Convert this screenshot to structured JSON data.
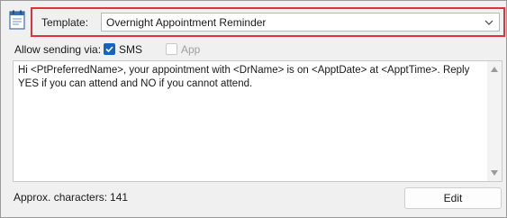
{
  "template": {
    "label": "Template:",
    "selected": "Overnight Appointment Reminder",
    "icon": "notepad-icon",
    "highlight_color": "#e0323d"
  },
  "sending": {
    "label": "Allow sending via:",
    "sms": {
      "label": "SMS",
      "checked": true
    },
    "app": {
      "label": "App",
      "checked": false,
      "disabled": true
    }
  },
  "message": {
    "text": "Hi <PtPreferredName>, your appointment with <DrName> is on <ApptDate> at <ApptTime>. Reply YES if you can attend and NO if you cannot attend."
  },
  "footer": {
    "approx_label": "Approx. characters:",
    "approx_count": "141",
    "edit_label": "Edit"
  },
  "colors": {
    "accent": "#1565c0"
  }
}
